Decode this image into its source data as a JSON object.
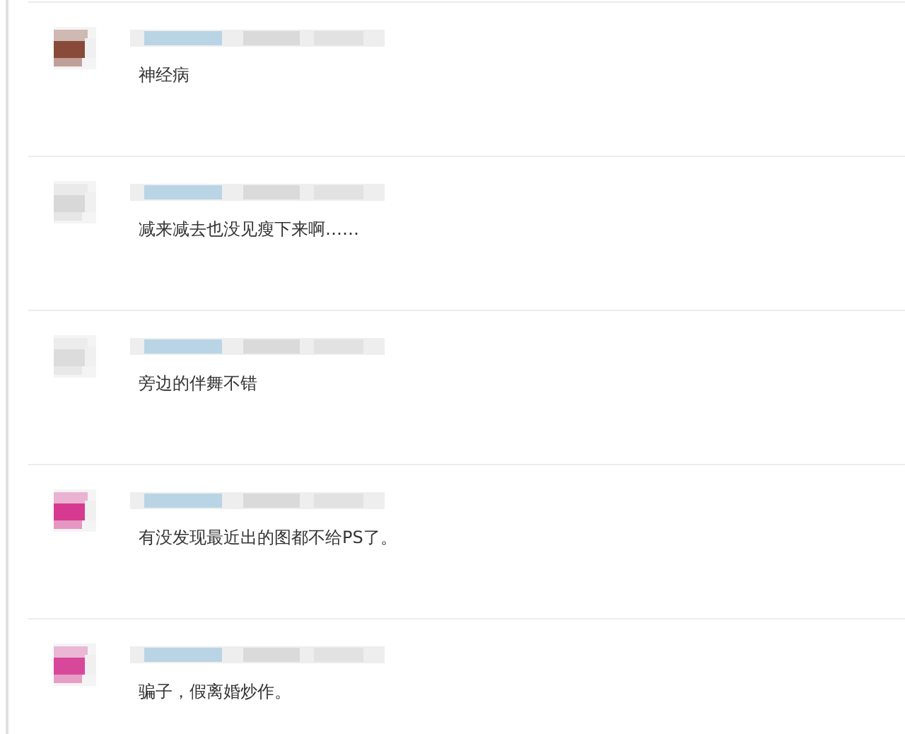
{
  "comments": [
    {
      "text": "神经病"
    },
    {
      "text": "减来减去也没见瘦下来啊……"
    },
    {
      "text": "旁边的伴舞不错"
    },
    {
      "text": "有没发现最近出的图都不给PS了。"
    },
    {
      "text": "骗子，假离婚炒作。"
    }
  ]
}
